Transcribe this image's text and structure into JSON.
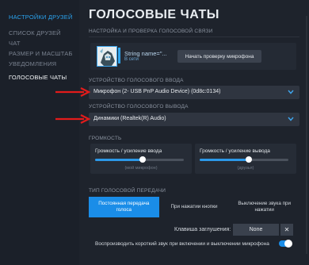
{
  "sidebar": {
    "title": "НАСТРОЙКИ ДРУЗЕЙ",
    "items": [
      {
        "label": "СПИСОК ДРУЗЕЙ"
      },
      {
        "label": "ЧАТ"
      },
      {
        "label": "РАЗМЕР И МАСШТАБ"
      },
      {
        "label": "УВЕДОМЛЕНИЯ"
      },
      {
        "label": "ГОЛОСОВЫЕ ЧАТЫ"
      }
    ]
  },
  "main": {
    "title": "ГОЛОСОВЫЕ ЧАТЫ",
    "mic_section": {
      "heading": "НАСТРОЙКА И ПРОВЕРКА ГОЛОСОВОЙ СВЯЗИ",
      "user_name": "String name=\"...",
      "user_status": "В сети",
      "test_button": "Начать проверку микрофона"
    },
    "input_device": {
      "heading": "УСТРОЙСТВО ГОЛОСОВОГО ВВОДА",
      "value": "Микрофон (2- USB PnP Audio Device) (0d8c:0134)"
    },
    "output_device": {
      "heading": "УСТРОЙСТВО ГОЛОСОВОГО ВЫВОДА",
      "value": "Динамики (Realtek(R) Audio)"
    },
    "volume": {
      "heading": "ГРОМКОСТЬ",
      "input": {
        "label": "Громкость / усиление ввода",
        "caption": "(мой микрофон)",
        "level": 0.54
      },
      "output": {
        "label": "Громкость / усиление вывода",
        "caption": "(друзья)",
        "level": 0.55
      }
    },
    "transmission": {
      "heading": "ТИП ГОЛОСОВОЙ ПЕРЕДАЧИ",
      "tabs": [
        {
          "label": "Постоянная передача голоса"
        },
        {
          "label": "При нажатии кнопки"
        },
        {
          "label": "Выключение звука при нажатии"
        }
      ],
      "key_label": "Клавиша заглушения:",
      "key_value": "None",
      "clear_symbol": "✕",
      "sound_label": "Воспроизводить короткий звук при включении и выключении микрофона",
      "sound_enabled": true
    }
  },
  "colors": {
    "accent": "#1a8de8",
    "sidebar_title": "#2aa3ef",
    "annotation_arrow": "#e21b1b"
  },
  "icons": [
    "chevron-down-icon",
    "close-icon",
    "avatar"
  ]
}
